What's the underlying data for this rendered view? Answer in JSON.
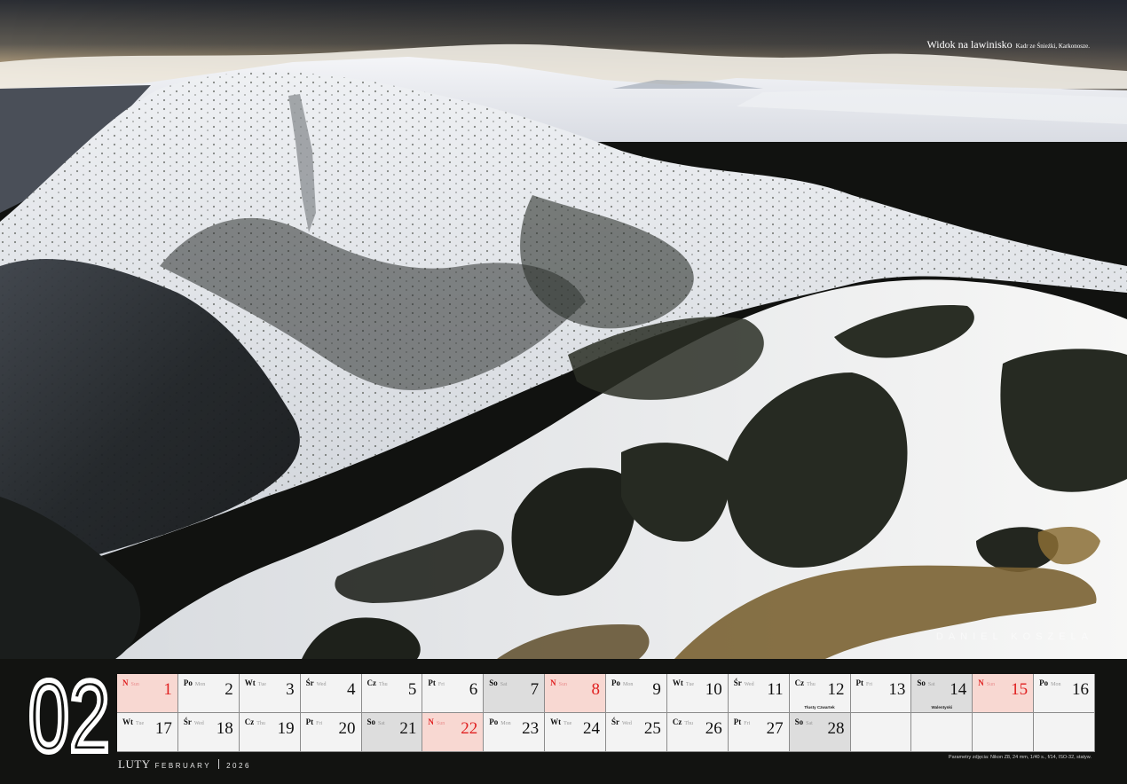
{
  "photo": {
    "title": "Widok na lawinisko",
    "subtitle": "Kadr ze Śnieżki, Karkonosze.",
    "watermark": "DANIEL KOSZELA"
  },
  "month": {
    "number": "02",
    "name_pl": "LUTY",
    "name_en": "FEBRUARY",
    "year": "2026"
  },
  "footnote": "Parametry zdjęcia: Nikon Z8, 24 mm, 1/40 s., f/14, ISO-32, statyw.",
  "calendar": {
    "row1": [
      {
        "pl": "N",
        "en": "Sun",
        "num": "1",
        "type": "sun",
        "holiday": ""
      },
      {
        "pl": "Po",
        "en": "Mon",
        "num": "2",
        "type": "",
        "holiday": ""
      },
      {
        "pl": "Wt",
        "en": "Tue",
        "num": "3",
        "type": "",
        "holiday": ""
      },
      {
        "pl": "Śr",
        "en": "Wed",
        "num": "4",
        "type": "",
        "holiday": ""
      },
      {
        "pl": "Cz",
        "en": "Thu",
        "num": "5",
        "type": "",
        "holiday": ""
      },
      {
        "pl": "Pt",
        "en": "Fri",
        "num": "6",
        "type": "",
        "holiday": ""
      },
      {
        "pl": "So",
        "en": "Sat",
        "num": "7",
        "type": "sat",
        "holiday": ""
      },
      {
        "pl": "N",
        "en": "Sun",
        "num": "8",
        "type": "sun",
        "holiday": ""
      },
      {
        "pl": "Po",
        "en": "Mon",
        "num": "9",
        "type": "",
        "holiday": ""
      },
      {
        "pl": "Wt",
        "en": "Tue",
        "num": "10",
        "type": "",
        "holiday": ""
      },
      {
        "pl": "Śr",
        "en": "Wed",
        "num": "11",
        "type": "",
        "holiday": ""
      },
      {
        "pl": "Cz",
        "en": "Thu",
        "num": "12",
        "type": "",
        "holiday": "Tłusty Czwartek"
      },
      {
        "pl": "Pt",
        "en": "Fri",
        "num": "13",
        "type": "",
        "holiday": ""
      },
      {
        "pl": "So",
        "en": "Sat",
        "num": "14",
        "type": "sat",
        "holiday": "Walentynki"
      },
      {
        "pl": "N",
        "en": "Sun",
        "num": "15",
        "type": "sun",
        "holiday": ""
      },
      {
        "pl": "Po",
        "en": "Mon",
        "num": "16",
        "type": "",
        "holiday": ""
      }
    ],
    "row2": [
      {
        "pl": "Wt",
        "en": "Tue",
        "num": "17",
        "type": "",
        "holiday": ""
      },
      {
        "pl": "Śr",
        "en": "Wed",
        "num": "18",
        "type": "",
        "holiday": ""
      },
      {
        "pl": "Cz",
        "en": "Thu",
        "num": "19",
        "type": "",
        "holiday": ""
      },
      {
        "pl": "Pt",
        "en": "Fri",
        "num": "20",
        "type": "",
        "holiday": ""
      },
      {
        "pl": "So",
        "en": "Sat",
        "num": "21",
        "type": "sat",
        "holiday": ""
      },
      {
        "pl": "N",
        "en": "Sun",
        "num": "22",
        "type": "sun",
        "holiday": ""
      },
      {
        "pl": "Po",
        "en": "Mon",
        "num": "23",
        "type": "",
        "holiday": ""
      },
      {
        "pl": "Wt",
        "en": "Tue",
        "num": "24",
        "type": "",
        "holiday": ""
      },
      {
        "pl": "Śr",
        "en": "Wed",
        "num": "25",
        "type": "",
        "holiday": ""
      },
      {
        "pl": "Cz",
        "en": "Thu",
        "num": "26",
        "type": "",
        "holiday": ""
      },
      {
        "pl": "Pt",
        "en": "Fri",
        "num": "27",
        "type": "",
        "holiday": ""
      },
      {
        "pl": "So",
        "en": "Sat",
        "num": "28",
        "type": "sat",
        "holiday": ""
      },
      {
        "pl": "",
        "en": "",
        "num": "",
        "type": "empty",
        "holiday": ""
      },
      {
        "pl": "",
        "en": "",
        "num": "",
        "type": "empty",
        "holiday": ""
      },
      {
        "pl": "",
        "en": "",
        "num": "",
        "type": "empty",
        "holiday": ""
      },
      {
        "pl": "",
        "en": "",
        "num": "",
        "type": "empty",
        "holiday": ""
      }
    ]
  },
  "colors": {
    "sunday_red": "#e02020",
    "sunday_bg": "#f8d8d2",
    "saturday_bg": "#dddddd",
    "strip_bg": "#121311"
  }
}
